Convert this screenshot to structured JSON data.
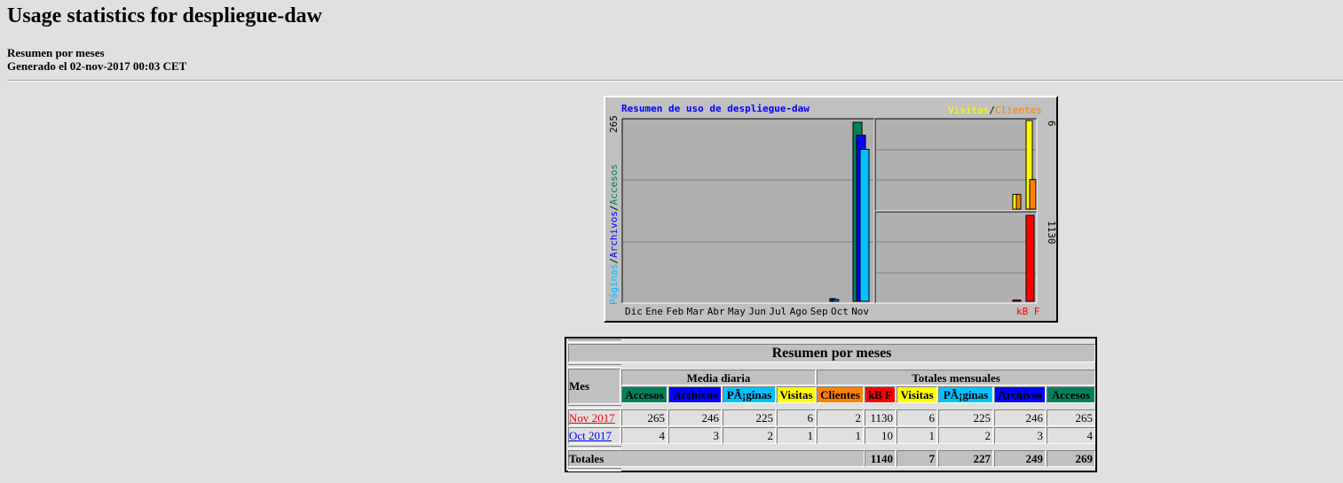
{
  "header": {
    "title": "Usage statistics for despliegue-daw",
    "subtitle": "Resumen por meses",
    "generated": "Generado el 02-nov-2017 00:03 CET"
  },
  "chart_data": {
    "type": "bar",
    "title": "Resumen de uso de despliegue-daw",
    "categories": [
      "Dic",
      "Ene",
      "Feb",
      "Mar",
      "Abr",
      "May",
      "Jun",
      "Jul",
      "Ago",
      "Sep",
      "Oct",
      "Nov"
    ],
    "left_panel": {
      "ylabel_parts": [
        "Páginas",
        "/",
        "Archivos",
        "/",
        "Accesos"
      ],
      "ymax_label": "265",
      "ymax": 265,
      "series": [
        {
          "name": "Accesos",
          "color": "#00805c",
          "values": [
            0,
            0,
            0,
            0,
            0,
            0,
            0,
            0,
            0,
            0,
            4,
            265
          ]
        },
        {
          "name": "Archivos",
          "color": "#0000ff",
          "values": [
            0,
            0,
            0,
            0,
            0,
            0,
            0,
            0,
            0,
            0,
            3,
            246
          ]
        },
        {
          "name": "Páginas",
          "color": "#00c0ff",
          "values": [
            0,
            0,
            0,
            0,
            0,
            0,
            0,
            0,
            0,
            0,
            2,
            225
          ]
        }
      ]
    },
    "right_top_panel": {
      "legend_parts": [
        "Visitas",
        "/",
        "Clientes"
      ],
      "ymax_label": "6",
      "ymax": 6,
      "series": [
        {
          "name": "Visitas",
          "color": "#ffff00",
          "values": [
            1,
            6
          ]
        },
        {
          "name": "Clientes",
          "color": "#ff8000",
          "values": [
            1,
            2
          ]
        }
      ]
    },
    "right_bottom_panel": {
      "ylabel": "kB F",
      "ymax_label": "1130",
      "ymax": 1130,
      "series": [
        {
          "name": "kB F",
          "color": "#ff0000",
          "values": [
            10,
            1130
          ]
        }
      ]
    },
    "grid": true
  },
  "table": {
    "title": "Resumen por meses",
    "mes_label": "Mes",
    "group_daily": "Media diaria",
    "group_totals": "Totales mensuales",
    "columns": [
      "Accesos",
      "Archivos",
      "PÃ¡ginas",
      "Visitas",
      "Clientes",
      "kB F",
      "Visitas",
      "PÃ¡ginas",
      "Archivos",
      "Accesos"
    ],
    "column_colors": [
      "#00805c",
      "#0000ff",
      "#00c0ff",
      "#ffff00",
      "#ff8000",
      "#ff0000",
      "#ffff00",
      "#00c0ff",
      "#0000ff",
      "#00805c"
    ],
    "rows": [
      {
        "month": "Nov 2017",
        "link_color": "#ff0000",
        "values": [
          "265",
          "246",
          "225",
          "6",
          "2",
          "1130",
          "6",
          "225",
          "246",
          "265"
        ]
      },
      {
        "month": "Oct 2017",
        "link_color": "#0000ff",
        "values": [
          "4",
          "3",
          "2",
          "1",
          "1",
          "10",
          "1",
          "2",
          "3",
          "4"
        ]
      }
    ],
    "totals_label": "Totales",
    "totals": [
      "1140",
      "7",
      "227",
      "249",
      "269"
    ]
  }
}
